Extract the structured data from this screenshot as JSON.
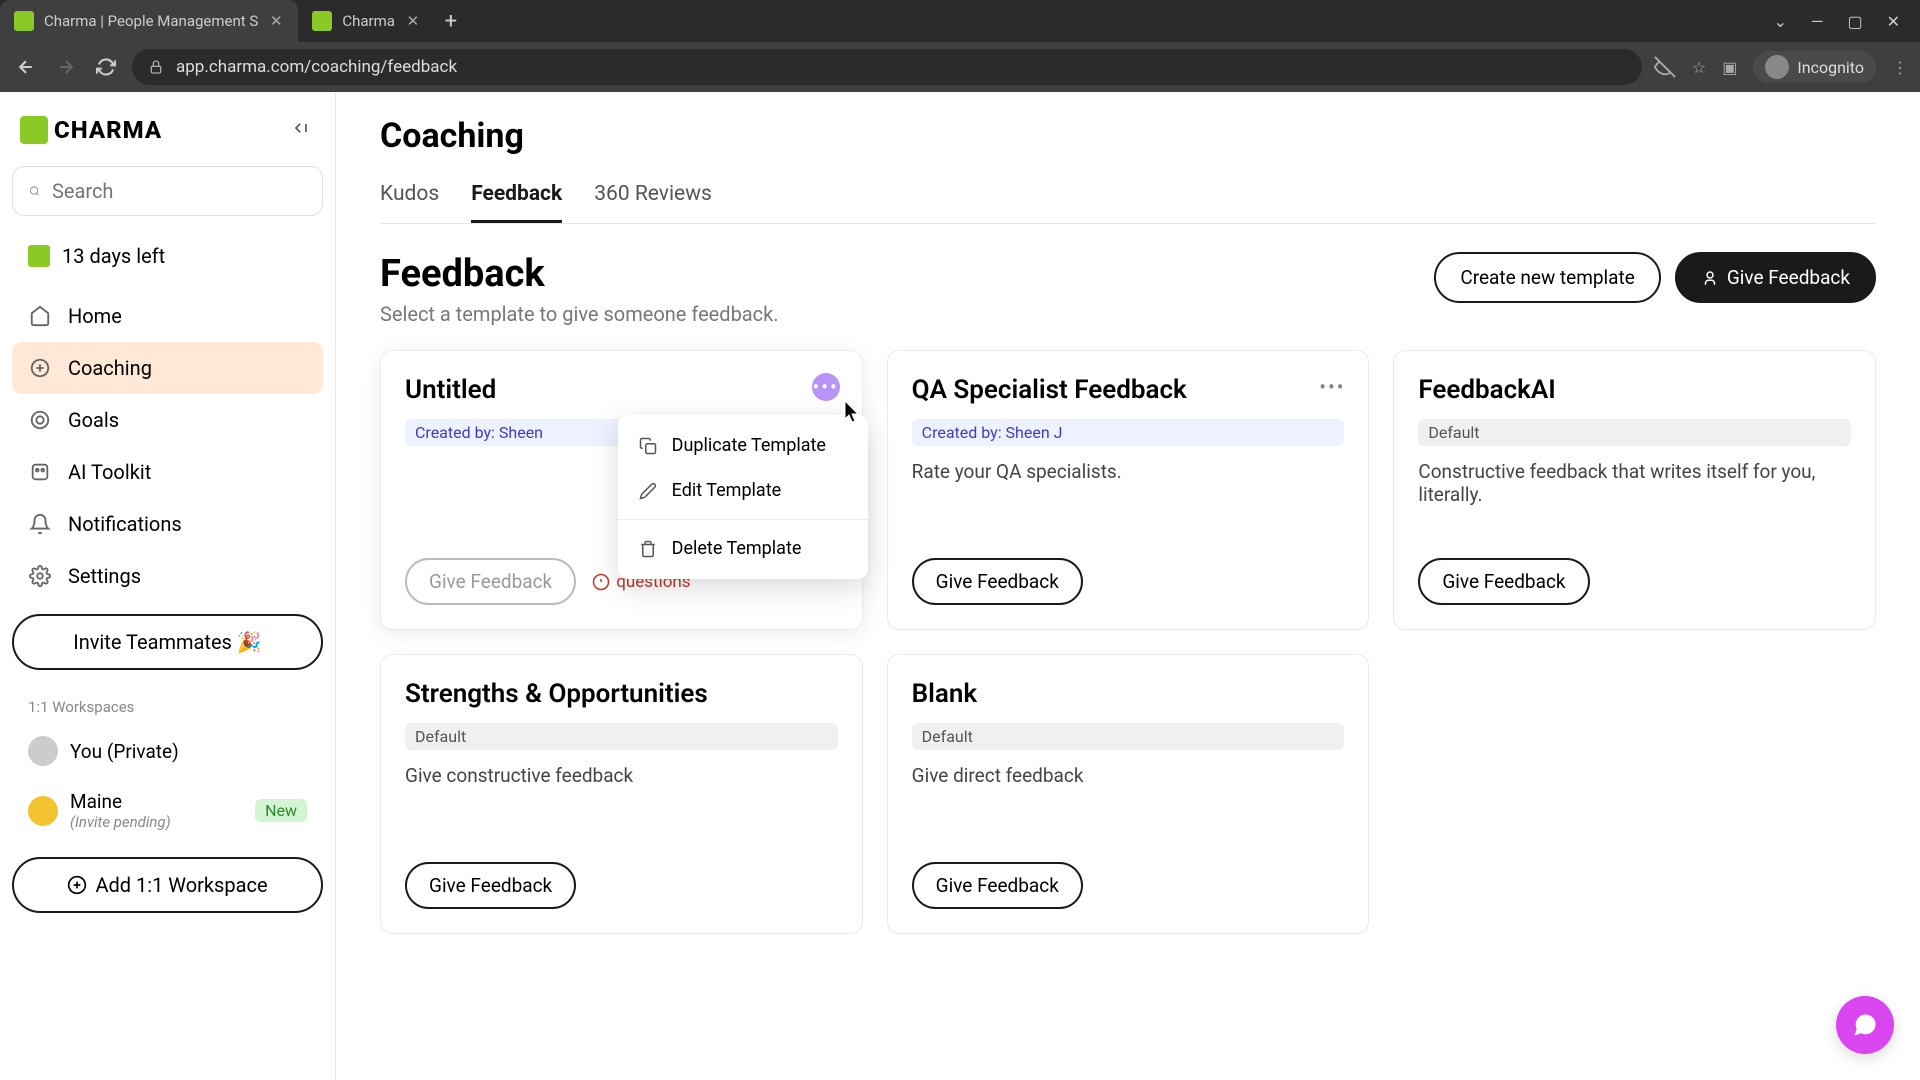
{
  "browser": {
    "tabs": [
      {
        "title": "Charma | People Management S"
      },
      {
        "title": "Charma"
      }
    ],
    "url": "app.charma.com/coaching/feedback",
    "incognito_label": "Incognito"
  },
  "sidebar": {
    "logo_text": "CHARMA",
    "search_placeholder": "Search",
    "trial_text": "13 days left",
    "nav": [
      {
        "label": "Home"
      },
      {
        "label": "Coaching"
      },
      {
        "label": "Goals"
      },
      {
        "label": "AI Toolkit"
      },
      {
        "label": "Notifications"
      },
      {
        "label": "Settings"
      }
    ],
    "invite_label": "Invite Teammates 🎉",
    "ws_section_label": "1:1 Workspaces",
    "workspaces": [
      {
        "name": "You (Private)"
      },
      {
        "name": "Maine",
        "sub": "(Invite pending)",
        "badge": "New"
      }
    ],
    "add_ws_label": "Add 1:1 Workspace"
  },
  "page": {
    "title": "Coaching",
    "tabs": [
      {
        "label": "Kudos"
      },
      {
        "label": "Feedback"
      },
      {
        "label": "360 Reviews"
      }
    ],
    "section_title": "Feedback",
    "section_sub": "Select a template to give someone feedback.",
    "create_btn": "Create new template",
    "give_btn": "Give Feedback"
  },
  "cards": [
    {
      "title": "Untitled",
      "badge": "Created by: Sheen",
      "badge_type": "creator",
      "action": "Give Feedback",
      "warning": "questions"
    },
    {
      "title": "QA Specialist Feedback",
      "badge": "Created by: Sheen J",
      "badge_type": "creator",
      "desc": "Rate your QA specialists.",
      "action": "Give Feedback"
    },
    {
      "title": "FeedbackAI",
      "badge": "Default",
      "badge_type": "default",
      "desc": "Constructive feedback that writes itself for you, literally.",
      "action": "Give Feedback"
    },
    {
      "title": "Strengths & Opportunities",
      "badge": "Default",
      "badge_type": "default",
      "desc": "Give constructive feedback",
      "action": "Give Feedback"
    },
    {
      "title": "Blank",
      "badge": "Default",
      "badge_type": "default",
      "desc": "Give direct feedback",
      "action": "Give Feedback"
    }
  ],
  "dropdown": {
    "duplicate": "Duplicate Template",
    "edit": "Edit Template",
    "delete": "Delete Template"
  }
}
